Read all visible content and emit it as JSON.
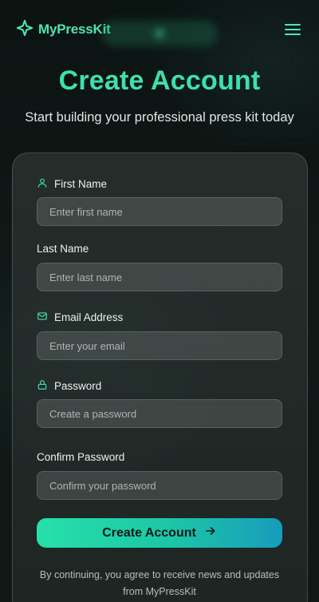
{
  "brand": {
    "name": "MyPressKit",
    "accent": "#3ee0ac"
  },
  "header": {
    "menu_icon": "hamburger-menu-icon"
  },
  "page": {
    "title": "Create Account",
    "subtitle": "Start building your professional press kit today"
  },
  "form": {
    "first_name": {
      "label": "First Name",
      "placeholder": "Enter first name",
      "icon": "user-icon"
    },
    "last_name": {
      "label": "Last Name",
      "placeholder": "Enter last name"
    },
    "email": {
      "label": "Email Address",
      "placeholder": "Enter your email",
      "icon": "mail-icon"
    },
    "password": {
      "label": "Password",
      "placeholder": "Create a password",
      "icon": "lock-icon"
    },
    "confirm_password": {
      "label": "Confirm Password",
      "placeholder": "Confirm your password"
    },
    "submit_label": "Create Account",
    "terms_text": "By continuing, you agree to receive news and updates from MyPressKit"
  },
  "colors": {
    "cta_gradient_start": "#27e0a8",
    "cta_gradient_end": "#189bbd",
    "background": "#0f1816"
  }
}
